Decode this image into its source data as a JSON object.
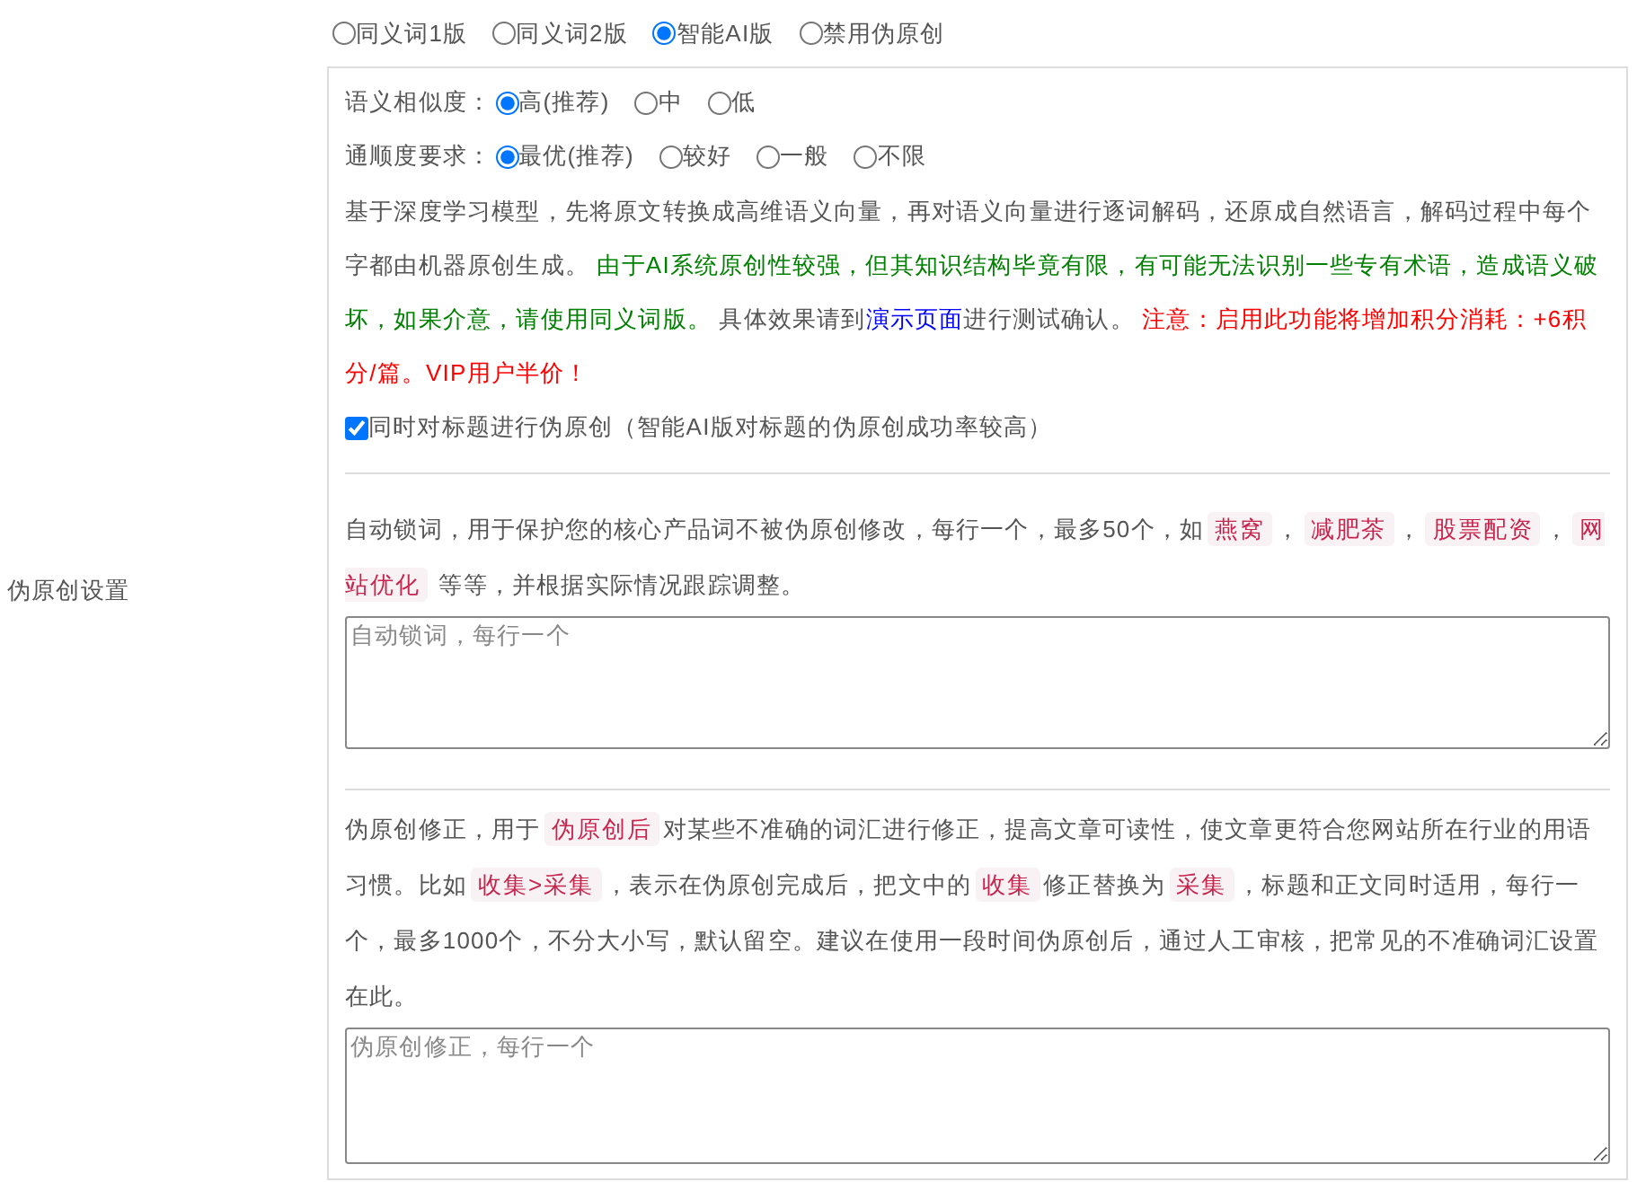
{
  "mode_options": [
    {
      "label": "同义词1版",
      "selected": false
    },
    {
      "label": "同义词2版",
      "selected": false
    },
    {
      "label": "智能AI版",
      "selected": true
    },
    {
      "label": "禁用伪原创",
      "selected": false
    }
  ],
  "section_label": "伪原创设置",
  "similarity": {
    "label": "语义相似度：",
    "options": [
      {
        "label": "高(推荐)",
        "selected": true
      },
      {
        "label": "中",
        "selected": false
      },
      {
        "label": "低",
        "selected": false
      }
    ]
  },
  "fluency": {
    "label": "通顺度要求：",
    "options": [
      {
        "label": "最优(推荐)",
        "selected": true
      },
      {
        "label": "较好",
        "selected": false
      },
      {
        "label": "一般",
        "selected": false
      },
      {
        "label": "不限",
        "selected": false
      }
    ]
  },
  "description": [
    {
      "kind": "text",
      "text": "基于深度学习模型，先将原文转换成高维语义向量，再对语义向量进行逐词解码，还原成自然语言，解码过程中每个字都由机器原创生成。 "
    },
    {
      "kind": "note",
      "text": "由于AI系统原创性较强，但其知识结构毕竟有限，有可能无法识别一些专有术语，造成语义破坏，如果介意，请使用同义词版。"
    },
    {
      "kind": "text",
      "text": " 具体效果请到"
    },
    {
      "kind": "link",
      "text": "演示页面"
    },
    {
      "kind": "text",
      "text": "进行测试确认。 "
    },
    {
      "kind": "warning",
      "text": "注意：启用此功能将增加积分消耗：+6积分/篇。VIP用户半价！"
    }
  ],
  "title_option": {
    "label": "同时对标题进行伪原创（智能AI版对标题的伪原创成功率较高）",
    "checked": true
  },
  "lock_words": {
    "description": [
      {
        "kind": "text",
        "text": "自动锁词，用于保护您的核心产品词不被伪原创修改，每行一个，最多50个，如"
      },
      {
        "kind": "code",
        "text": "燕窝"
      },
      {
        "kind": "text",
        "text": "，"
      },
      {
        "kind": "code",
        "text": "减肥茶"
      },
      {
        "kind": "text",
        "text": "，"
      },
      {
        "kind": "code",
        "text": "股票配资"
      },
      {
        "kind": "text",
        "text": "，"
      },
      {
        "kind": "code",
        "text": "网站优化"
      },
      {
        "kind": "text",
        "text": " 等等，并根据实际情况跟踪调整。"
      }
    ],
    "placeholder": "自动锁词，每行一个"
  },
  "corrections": {
    "description": [
      {
        "kind": "text",
        "text": "伪原创修正，用于"
      },
      {
        "kind": "code",
        "text": "伪原创后"
      },
      {
        "kind": "text",
        "text": "对某些不准确的词汇进行修正，提高文章可读性，使文章更符合您网站所在行业的用语习惯。比如"
      },
      {
        "kind": "code",
        "text": "收集>采集"
      },
      {
        "kind": "text",
        "text": "，表示在伪原创完成后，把文中的"
      },
      {
        "kind": "code",
        "text": "收集"
      },
      {
        "kind": "text",
        "text": "修正替换为"
      },
      {
        "kind": "code",
        "text": "采集"
      },
      {
        "kind": "text",
        "text": "，标题和正文同时适用，每行一个，最多1000个，不分大小写，默认留空。建议在使用一段时间伪原创后，通过人工审核，把常见的不准确词汇设置在此。"
      }
    ],
    "placeholder": "伪原创修正，每行一个"
  }
}
